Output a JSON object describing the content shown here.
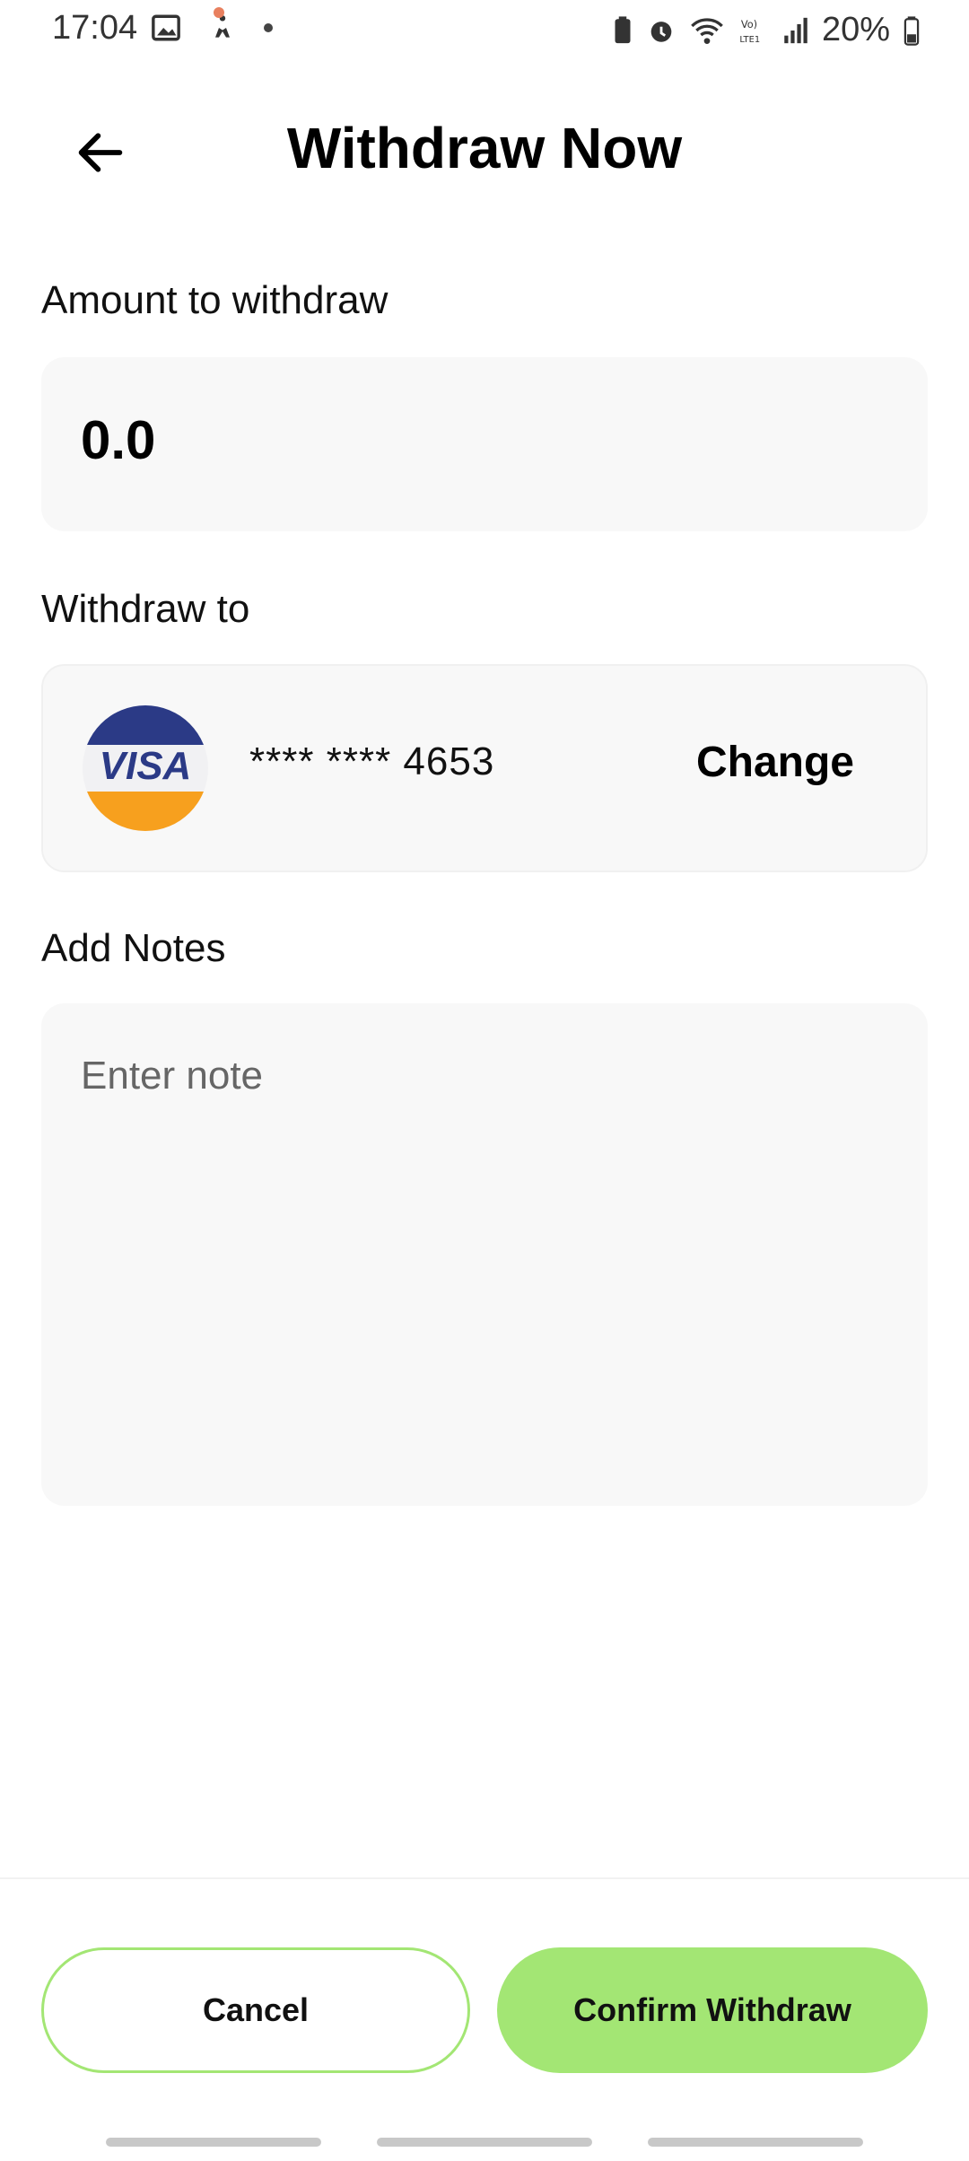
{
  "status_bar": {
    "time": "17:04",
    "battery_percent": "20%"
  },
  "header": {
    "title": "Withdraw Now"
  },
  "amount": {
    "label": "Amount to withdraw",
    "value": "0.0"
  },
  "withdraw_to": {
    "label": "Withdraw to",
    "card_brand": "VISA",
    "card_number": "**** **** 4653",
    "change_label": "Change"
  },
  "notes": {
    "label": "Add Notes",
    "placeholder": "Enter note",
    "value": ""
  },
  "actions": {
    "cancel_label": "Cancel",
    "confirm_label": "Confirm Withdraw"
  },
  "colors": {
    "accent": "#a3e674",
    "field_bg": "#f8f8f8",
    "visa_blue": "#2b3a86",
    "visa_orange": "#f7a01e"
  }
}
